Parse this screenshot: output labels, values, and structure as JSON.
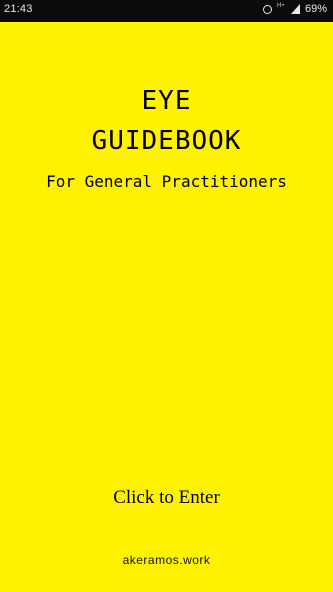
{
  "status_bar": {
    "time": "21:43",
    "battery": "69%",
    "wifi_badge": "H+",
    "icons": [
      "alarm-icon",
      "signal-icon"
    ]
  },
  "main": {
    "title_line1": "EYE",
    "title_line2": "GUIDEBOOK",
    "subtitle": "For General Practitioners",
    "enter_label": "Click to Enter",
    "footer": "akeramos.work"
  },
  "colors": {
    "background": "#FFF200",
    "text": "#000000",
    "status_bar": "#0B0B0B"
  }
}
